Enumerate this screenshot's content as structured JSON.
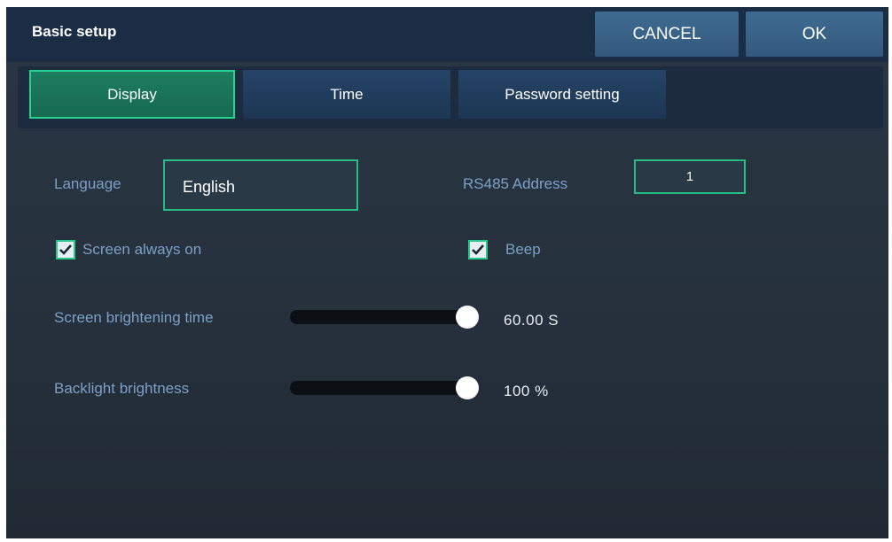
{
  "header": {
    "title": "Basic setup",
    "cancel_label": "CANCEL",
    "ok_label": "OK"
  },
  "tabs": [
    {
      "label": "Display",
      "active": true
    },
    {
      "label": "Time",
      "active": false
    },
    {
      "label": "Password setting",
      "active": false
    }
  ],
  "display": {
    "language_label": "Language",
    "language_value": "English",
    "rs485_label": "RS485 Address",
    "rs485_value": "1",
    "screen_always_on_label": "Screen always on",
    "screen_always_on_checked": true,
    "beep_label": "Beep",
    "beep_checked": true,
    "brightening_label": "Screen brightening time",
    "brightening_value": "60.00 S",
    "brightening_level": 1.0,
    "backlight_label": "Backlight brightness",
    "backlight_value": "100 %",
    "backlight_level": 1.0
  },
  "colors": {
    "accent_green": "#27d291",
    "title_bar": "#1b2d45",
    "label_blue": "#7ba0c6"
  }
}
